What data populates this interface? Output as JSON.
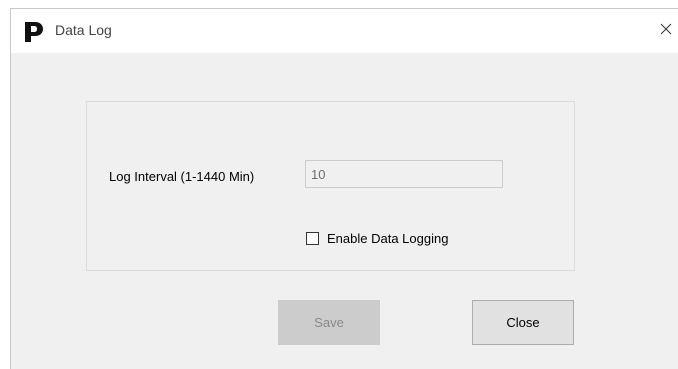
{
  "window": {
    "title": "Data Log",
    "icon": "p-logo-icon",
    "close_icon": "close-icon"
  },
  "form": {
    "interval_label": "Log Interval (1-1440 Min)",
    "interval_value": "10",
    "interval_enabled": false,
    "checkbox_label": "Enable Data Logging",
    "checkbox_checked": false
  },
  "buttons": {
    "save_label": "Save",
    "save_enabled": false,
    "close_label": "Close"
  },
  "colors": {
    "window_bg": "#f0f0f0",
    "titlebar_bg": "#ffffff",
    "disabled_text": "#8a8a8a"
  }
}
